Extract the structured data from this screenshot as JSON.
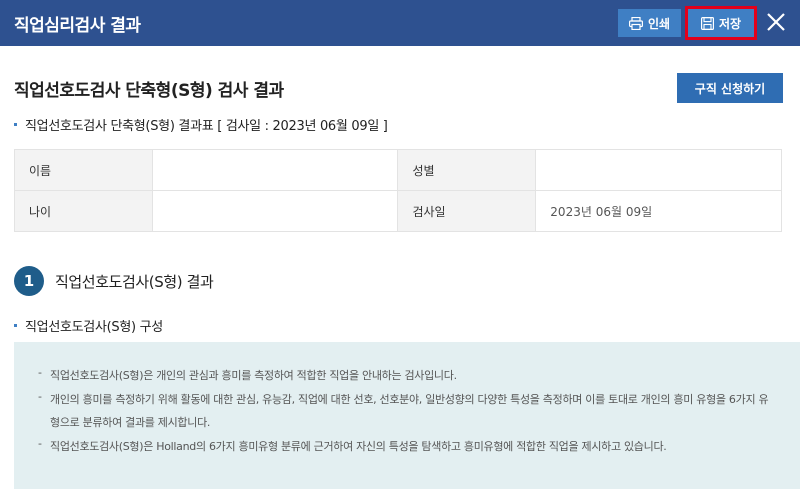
{
  "header": {
    "title": "직업심리검사 결과",
    "print_label": "인쇄",
    "save_label": "저장",
    "close_icon": "close-icon"
  },
  "main": {
    "page_title": "직업선호도검사 단축형(S형) 검사 결과",
    "apply_label": "구직 신청하기",
    "result_table_heading": "직업선호도검사 단축형(S형) 결과표 [ 검사일 : 2023년 06월 09일 ]",
    "info_table": {
      "name_label": "이름",
      "name_value": "",
      "gender_label": "성별",
      "gender_value": "",
      "age_label": "나이",
      "age_value": "",
      "date_label": "검사일",
      "date_value": "2023년 06월 09일"
    },
    "section1": {
      "number": "1",
      "title": "직업선호도검사(S형) 결과",
      "sub_heading": "직업선호도검사(S형) 구성",
      "description": [
        "직업선호도검사(S형)은 개인의 관심과 흥미를 측정하여 적합한 직업을 안내하는 검사입니다.",
        "개인의 흥미를 측정하기 위해 활동에 대한 관심, 유능감, 직업에 대한 선호, 선호분야, 일반성향의 다양한 특성을 측정하며 이를 토대로 개인의 흥미 유형을 6가지 유형으로 분류하여 결과를 제시합니다.",
        "직업선호도검사(S형)은 Holland의 6가지 흥미유형 분류에 근거하여 자신의 특성을 탐색하고 흥미유형에 적합한 직업을 제시하고 있습니다."
      ]
    }
  },
  "colors": {
    "header_bg": "#2e5190",
    "button_blue": "#3f7fc4",
    "highlight_red": "#e3001b",
    "number_circle": "#1f5d8a",
    "desc_bg": "#e3eff1"
  }
}
